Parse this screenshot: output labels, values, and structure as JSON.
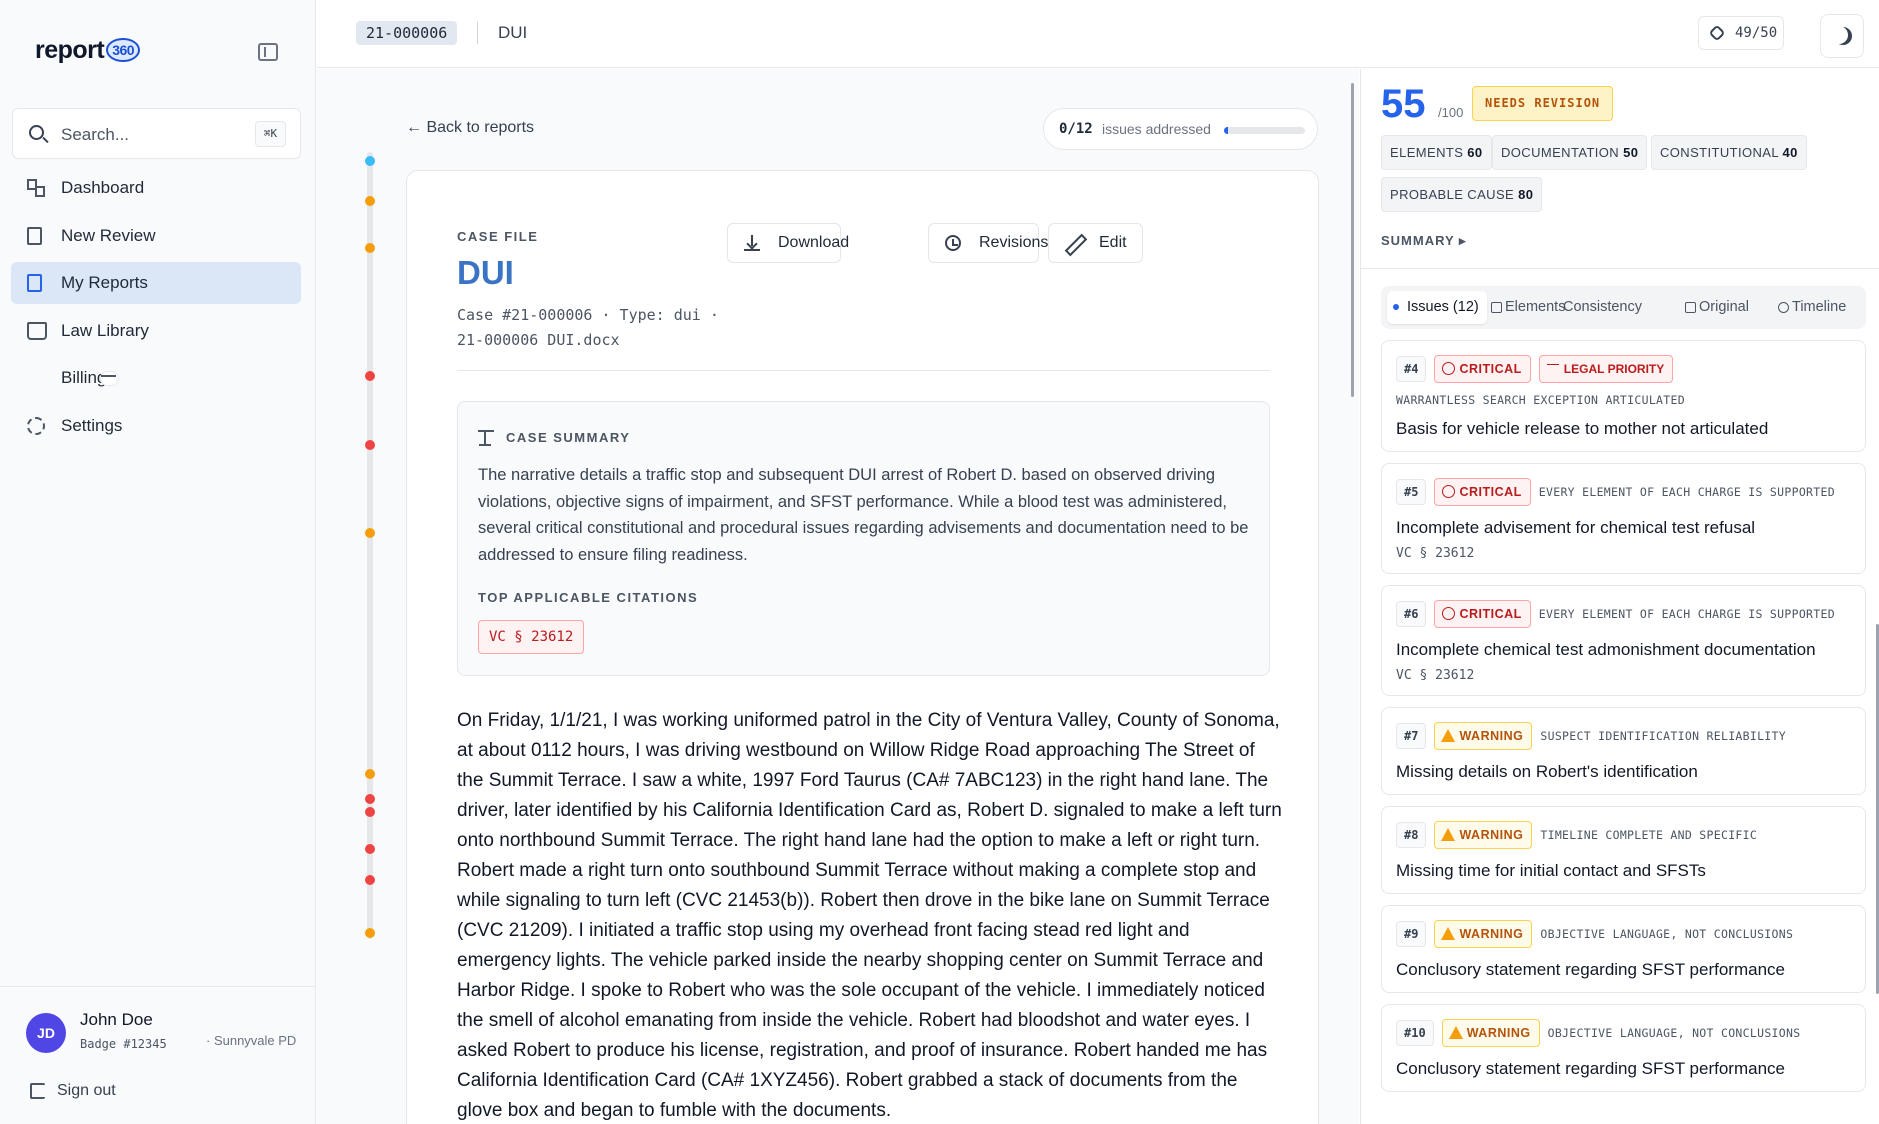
{
  "app": {
    "logo_text": "report",
    "logo_number": "360"
  },
  "sidebar": {
    "search_placeholder": "Search...",
    "search_shortcut": "⌘K",
    "items": [
      {
        "label": "Dashboard",
        "icon": "dashboard-grid-icon"
      },
      {
        "label": "New Review",
        "icon": "new-review-icon"
      },
      {
        "label": "My Reports",
        "icon": "reports-icon",
        "active": true
      },
      {
        "label": "Law Library",
        "icon": "book-icon"
      },
      {
        "label": "Billing",
        "icon": "credit-card-icon"
      },
      {
        "label": "Settings",
        "icon": "gear-icon"
      }
    ],
    "user": {
      "initials": "JD",
      "name": "John Doe",
      "badge": "Badge #12345",
      "department": "· Sunnyvale PD"
    },
    "sign_out": "Sign out"
  },
  "topbar": {
    "case_number": "21-000006",
    "case_type": "DUI",
    "credits": "49/50"
  },
  "main": {
    "back_label": "← Back to reports",
    "progress": {
      "count": "0/12",
      "label": "issues addressed",
      "fraction": 0.05
    },
    "case_file_label": "CASE FILE",
    "title": "DUI",
    "meta_line1": "Case #21-000006  ·  Type: dui  ·",
    "meta_line2": "21-000006 DUI.docx",
    "buttons": {
      "download": "Download",
      "revisions": "Revisions",
      "edit": "Edit"
    },
    "summary": {
      "label": "CASE SUMMARY",
      "text": "The narrative details a traffic stop and subsequent DUI arrest of Robert D. based on observed driving violations, objective signs of impairment, and SFST performance. While a blood test was administered, several critical constitutional and procedural issues regarding advisements and documentation need to be addressed to ensure filing readiness.",
      "citations_label": "TOP APPLICABLE CITATIONS",
      "citation": "VC § 23612"
    },
    "narrative": "On Friday, 1/1/21, I was working uniformed patrol in the City of Ventura Valley, County of Sonoma, at about 0112 hours, I was driving westbound on Willow Ridge Road approaching The Street of the Summit Terrace. I saw a white, 1997 Ford Taurus (CA# 7ABC123) in the right hand lane. The driver, later identified by his California Identification Card as, Robert D. signaled to make a left turn onto northbound Summit Terrace. The right hand lane had the option to make a left or right turn. Robert made a right turn onto southbound Summit Terrace without making a complete stop and while signaling to turn left (CVC 21453(b)). Robert then drove in the bike lane on Summit Terrace (CVC 21209). I initiated a traffic stop using my overhead front facing stead red light and emergency lights. The vehicle parked inside the nearby shopping center on Summit Terrace and Harbor Ridge. I spoke to Robert who was the sole occupant of the vehicle. I immediately noticed the smell of alcohol emanating from inside the vehicle. Robert had bloodshot and water eyes. I asked Robert to produce his license, registration, and proof of insurance. Robert handed me has California Identification Card (CA# 1XYZ456). Robert grabbed a stack of documents from the glove box and began to fumble with the documents."
  },
  "timeline_dots": [
    {
      "color": "#38bdf8"
    },
    {
      "color": "#f59e0b"
    },
    {
      "color": "#f59e0b"
    },
    {
      "color": "#ef4444"
    },
    {
      "color": "#ef4444"
    },
    {
      "color": "#f59e0b"
    },
    {
      "color": "#f59e0b"
    },
    {
      "color": "#ef4444"
    },
    {
      "color": "#ef4444"
    },
    {
      "color": "#ef4444"
    },
    {
      "color": "#ef4444"
    },
    {
      "color": "#f59e0b"
    }
  ],
  "panel": {
    "score": "55",
    "score_max": "/100",
    "status": "NEEDS REVISION",
    "metrics": [
      {
        "label": "ELEMENTS",
        "value": "60"
      },
      {
        "label": "DOCUMENTATION",
        "value": "50"
      },
      {
        "label": "CONSTITUTIONAL",
        "value": "40"
      },
      {
        "label": "PROBABLE CAUSE",
        "value": "80"
      }
    ],
    "summary_toggle": "SUMMARY ▸",
    "tabs": [
      {
        "label": "Issues (12)"
      },
      {
        "label": "Elements"
      },
      {
        "label": "Consistency"
      },
      {
        "label": "Original"
      },
      {
        "label": "Timeline"
      }
    ],
    "issues": [
      {
        "num": "#4",
        "severity": "CRITICAL",
        "legal": "LEGAL PRIORITY",
        "category": "WARRANTLESS SEARCH EXCEPTION ARTICULATED",
        "title": "Basis for vehicle release to mother not articulated",
        "cite": ""
      },
      {
        "num": "#5",
        "severity": "CRITICAL",
        "legal": "",
        "category": "EVERY ELEMENT OF EACH CHARGE IS SUPPORTED",
        "title": "Incomplete advisement for chemical test refusal",
        "cite": "VC § 23612"
      },
      {
        "num": "#6",
        "severity": "CRITICAL",
        "legal": "",
        "category": "EVERY ELEMENT OF EACH CHARGE IS SUPPORTED",
        "title": "Incomplete chemical test admonishment documentation",
        "cite": "VC § 23612"
      },
      {
        "num": "#7",
        "severity": "WARNING",
        "legal": "",
        "category": "SUSPECT IDENTIFICATION RELIABILITY",
        "title": "Missing details on Robert's  identification",
        "cite": ""
      },
      {
        "num": "#8",
        "severity": "WARNING",
        "legal": "",
        "category": "TIMELINE COMPLETE AND SPECIFIC",
        "title": "Missing time for initial contact and SFSTs",
        "cite": ""
      },
      {
        "num": "#9",
        "severity": "WARNING",
        "legal": "",
        "category": "OBJECTIVE LANGUAGE, NOT CONCLUSIONS",
        "title": "Conclusory statement regarding SFST performance",
        "cite": ""
      },
      {
        "num": "#10",
        "severity": "WARNING",
        "legal": "",
        "category": "OBJECTIVE LANGUAGE, NOT CONCLUSIONS",
        "title": "Conclusory statement regarding SFST performance",
        "cite": ""
      }
    ]
  }
}
